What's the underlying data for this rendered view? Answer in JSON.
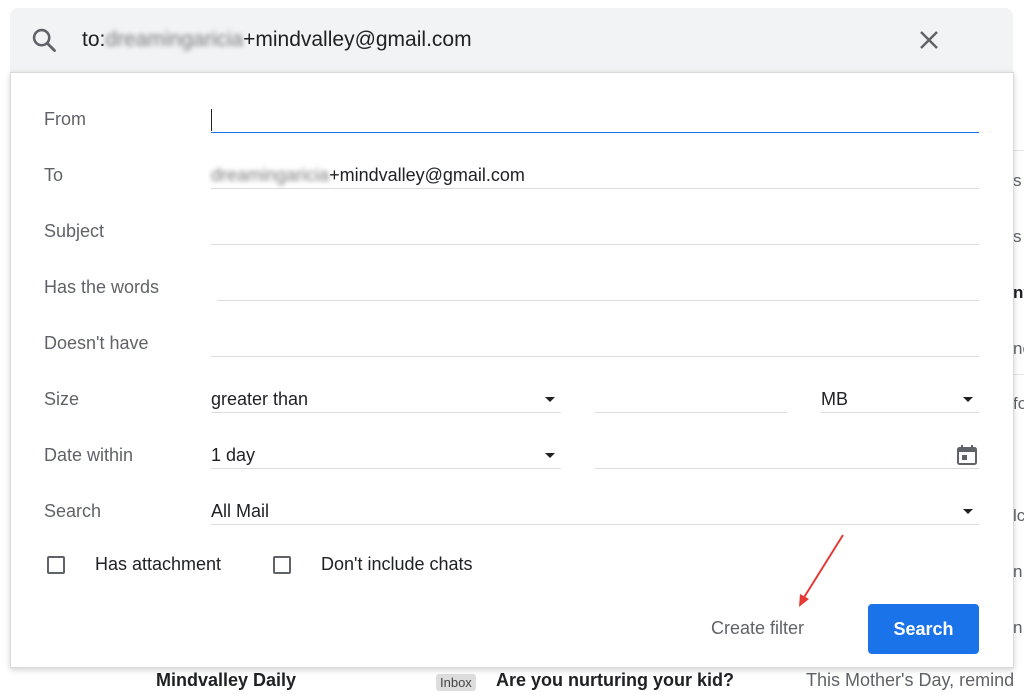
{
  "search_bar": {
    "prefix": "to:",
    "blurred": "dreamingaricia",
    "suffix": "+mindvalley@gmail.com"
  },
  "form": {
    "from": {
      "label": "From",
      "value": ""
    },
    "to": {
      "label": "To",
      "blurred": "dreamingaricia",
      "value": "+mindvalley@gmail.com"
    },
    "subject": {
      "label": "Subject",
      "value": ""
    },
    "has_words": {
      "label": "Has the words",
      "value": ""
    },
    "doesnt_have": {
      "label": "Doesn't have",
      "value": ""
    },
    "size": {
      "label": "Size",
      "comparator": "greater than",
      "amount": "",
      "unit": "MB"
    },
    "date_within": {
      "label": "Date within",
      "range": "1 day",
      "date": ""
    },
    "search_in": {
      "label": "Search",
      "scope": "All Mail"
    }
  },
  "checkboxes": {
    "has_attachment": {
      "label": "Has attachment",
      "checked": false
    },
    "dont_include_chats": {
      "label": "Don't include chats",
      "checked": false
    }
  },
  "actions": {
    "create_filter": "Create filter",
    "search": "Search"
  },
  "background": {
    "right_fragments": [
      "s y",
      "s",
      "ny",
      "ne",
      "fo",
      "lc",
      "n",
      "n i"
    ],
    "bottom_sender": "Mindvalley Daily",
    "bottom_label": "Inbox",
    "bottom_subject": "Are you nurturing your kid?",
    "bottom_snippet": "This Mother's Day, remind"
  },
  "colors": {
    "accent": "#1a73e8",
    "annotation_arrow": "#e53935",
    "search_bar_bg": "#f1f3f4"
  }
}
